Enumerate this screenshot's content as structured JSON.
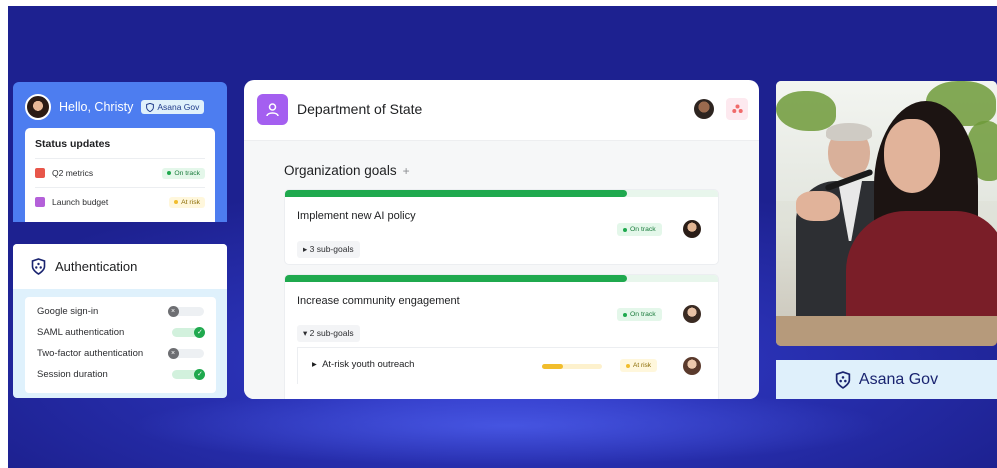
{
  "hello_card": {
    "greeting": "Hello, Christy",
    "badge": "Asana Gov",
    "status": {
      "title": "Status updates",
      "items": [
        {
          "label": "Q2 metrics",
          "status": "On track",
          "tone": "green"
        },
        {
          "label": "Launch budget",
          "status": "At risk",
          "tone": "yellow"
        }
      ]
    }
  },
  "auth_card": {
    "title": "Authentication",
    "settings": [
      {
        "label": "Google sign-in",
        "enabled": false
      },
      {
        "label": "SAML authentication",
        "enabled": true
      },
      {
        "label": "Two-factor authentication",
        "enabled": false
      },
      {
        "label": "Session duration",
        "enabled": true
      }
    ]
  },
  "main": {
    "title": "Department of State",
    "section_title": "Organization goals",
    "add_symbol": "+",
    "goals": [
      {
        "name": "Implement new AI policy",
        "status": "On track",
        "subgoals": "3 sub-goals",
        "progress": 0.79
      },
      {
        "name": "Increase community engagement",
        "status": "On track",
        "subgoals": "2 sub-goals",
        "progress": 0.79,
        "subgoal_items": [
          {
            "name": "At-risk youth outreach",
            "status": "At risk",
            "progress": 0.35
          }
        ]
      }
    ]
  },
  "right": {
    "label": "Asana Gov"
  },
  "colors": {
    "background": "#2a32b6",
    "accent_blue": "#4d7df0",
    "on_track": "#1fa94e",
    "at_risk": "#f1bd2c",
    "dept_icon": "#a45ff0"
  },
  "icons": {
    "gov_shield": "shield-icon",
    "dept": "person-icon",
    "asana": "asana-logo-icon"
  }
}
